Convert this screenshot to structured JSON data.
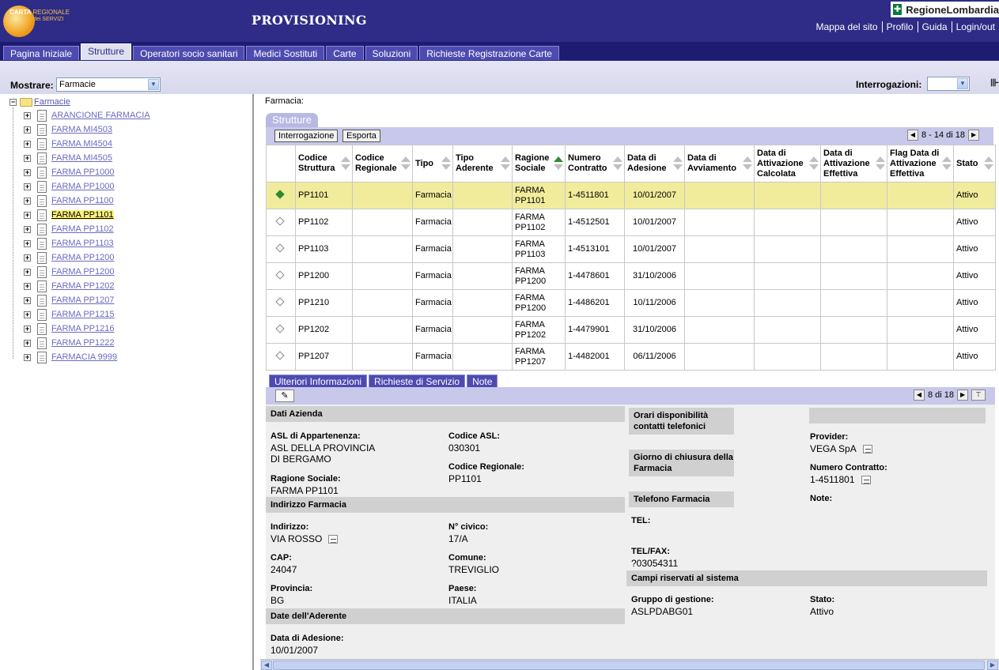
{
  "header": {
    "logo_line1a": "CARTA",
    "logo_line1b": "REGIONALE",
    "logo_line2": "dei SERVIZI",
    "title": "PROVISIONING",
    "brand": "RegioneLombardia",
    "links": [
      "Mappa del sito",
      "Profilo",
      "Guida",
      "Login/out"
    ]
  },
  "tabs": [
    "Pagina Iniziale",
    "Strutture",
    "Operatori socio sanitari",
    "Medici Sostituti",
    "Carte",
    "Soluzioni",
    "Richieste Registrazione Carte"
  ],
  "active_tab": "Strutture",
  "toolbar": {
    "mostrare_label": "Mostrare:",
    "mostrare_value": "Farmacie",
    "interrogazioni_label": "Interrogazioni:",
    "interrogazioni_value": ""
  },
  "tree": {
    "root": "Farmacie",
    "items": [
      "ARANCIONE FARMACIA",
      "FARMA MI4503",
      "FARMA MI4504",
      "FARMA MI4505",
      "FARMA PP1000",
      "FARMA PP1000",
      "FARMA PP1100",
      "FARMA PP1101",
      "FARMA PP1102",
      "FARMA PP1103",
      "FARMA PP1200",
      "FARMA PP1200",
      "FARMA PP1202",
      "FARMA PP1207",
      "FARMA PP1215",
      "FARMA PP1216",
      "FARMA PP1222",
      "FARMACIA 9999"
    ],
    "selected": "FARMA PP1101"
  },
  "main": {
    "farmacia_label": "Farmacia:",
    "panel_title": "Strutture",
    "btn_interrogazione": "Interrogazione",
    "btn_esporta": "Esporta",
    "pager_text": "8 - 14 di 18",
    "columns": [
      "",
      "Codice Struttura",
      "Codice Regionale",
      "Tipo",
      "Tipo Aderente",
      "Ragione Sociale",
      "Numero Contratto",
      "Data di Adesione",
      "Data di Avviamento",
      "Data di Attivazione Calcolata",
      "Data di Attivazione Effettiva",
      "Flag Data di Attivazione Effettiva",
      "Stato"
    ],
    "rows": [
      [
        "PP1101",
        "",
        "Farmacia",
        "",
        "FARMA PP1101",
        "1-4511801",
        "10/01/2007",
        "",
        "",
        "",
        "",
        "Attivo"
      ],
      [
        "PP1102",
        "",
        "Farmacia",
        "",
        "FARMA PP1102",
        "1-4512501",
        "10/01/2007",
        "",
        "",
        "",
        "",
        "Attivo"
      ],
      [
        "PP1103",
        "",
        "Farmacia",
        "",
        "FARMA PP1103",
        "1-4513101",
        "10/01/2007",
        "",
        "",
        "",
        "",
        "Attivo"
      ],
      [
        "PP1200",
        "",
        "Farmacia",
        "",
        "FARMA PP1200",
        "1-4478601",
        "31/10/2006",
        "",
        "",
        "",
        "",
        "Attivo"
      ],
      [
        "PP1210",
        "",
        "Farmacia",
        "",
        "FARMA PP1200",
        "1-4486201",
        "10/11/2006",
        "",
        "",
        "",
        "",
        "Attivo"
      ],
      [
        "PP1202",
        "",
        "Farmacia",
        "",
        "FARMA PP1202",
        "1-4479901",
        "31/10/2006",
        "",
        "",
        "",
        "",
        "Attivo"
      ],
      [
        "PP1207",
        "",
        "Farmacia",
        "",
        "FARMA PP1207",
        "1-4482001",
        "06/11/2006",
        "",
        "",
        "",
        "",
        "Attivo"
      ]
    ],
    "selected_row": 0
  },
  "detail": {
    "subtabs": [
      "Ulteriori Informazioni",
      "Richieste di Servizio",
      "Note"
    ],
    "pager_text": "8 di 18",
    "sections": {
      "dati_azienda": "Dati Azienda",
      "indirizzo": "Indirizzo Farmacia",
      "date_aderente": "Date dell'Aderente",
      "orari": "Orari disponibilità contatti telefonici",
      "giorno_chiusura": "Giorno di chiusura della Farmacia",
      "telefono": "Telefono Farmacia",
      "campi_riservati": "Campi riservati al sistema"
    },
    "fields": {
      "asl_label": "ASL di Appartenenza:",
      "asl_value_1": "ASL DELLA PROVINCIA",
      "asl_value_2": "DI BERGAMO",
      "codice_asl_label": "Codice ASL:",
      "codice_asl_value": "030301",
      "codice_regionale_label": "Codice Regionale:",
      "codice_regionale_value": "PP1101",
      "ragione_label": "Ragione Sociale:",
      "ragione_value": "FARMA PP1101",
      "indirizzo_label": "Indirizzo:",
      "indirizzo_value": "VIA ROSSO",
      "civico_label": "N° civico:",
      "civico_value": "17/A",
      "cap_label": "CAP:",
      "cap_value": "24047",
      "comune_label": "Comune:",
      "comune_value": "TREVIGLIO",
      "provincia_label": "Provincia:",
      "provincia_value": "BG",
      "paese_label": "Paese:",
      "paese_value": "ITALIA",
      "adesione_label": "Data di Adesione:",
      "adesione_value": "10/01/2007",
      "tel_label": "TEL:",
      "telfax_label": "TEL/FAX:",
      "telfax_value": "?03054311",
      "provider_label": "Provider:",
      "provider_value": "VEGA SpA",
      "contratto_label": "Numero Contratto:",
      "contratto_value": "1-4511801",
      "note_label": "Note:",
      "gruppo_label": "Gruppo di gestione:",
      "gruppo_value": "ASLPDABG01",
      "stato_label": "Stato:",
      "stato_value": "Attivo"
    }
  }
}
